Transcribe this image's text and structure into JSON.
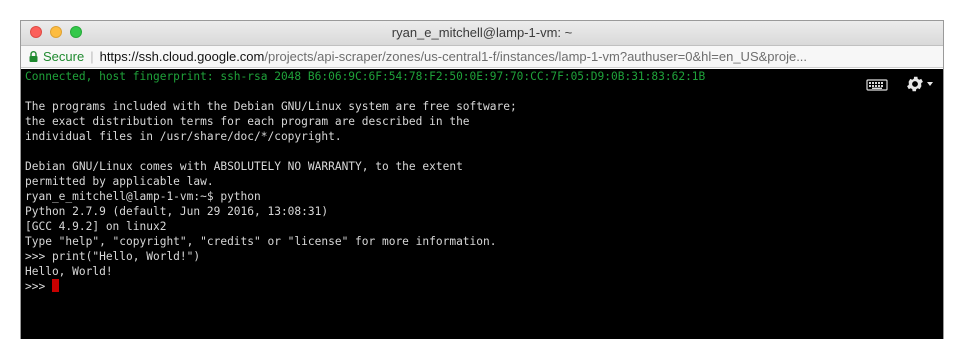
{
  "window": {
    "title": "ryan_e_mitchell@lamp-1-vm: ~"
  },
  "address_bar": {
    "secure_label": "Secure",
    "url_scheme": "https://",
    "url_host": "ssh.cloud.google.com",
    "url_path": "/projects/api-scraper/zones/us-central1-f/instances/lamp-1-vm?authuser=0&hl=en_US&proje..."
  },
  "terminal": {
    "connected": "Connected, host fingerprint: ssh-rsa 2048 B6:06:9C:6F:54:78:F2:50:0E:97:70:CC:7F:05:D9:0B:31:83:62:1B",
    "lines": [
      "The programs included with the Debian GNU/Linux system are free software;",
      "the exact distribution terms for each program are described in the",
      "individual files in /usr/share/doc/*/copyright.",
      "Debian GNU/Linux comes with ABSOLUTELY NO WARRANTY, to the extent",
      "permitted by applicable law.",
      "ryan_e_mitchell@lamp-1-vm:~$ python",
      "Python 2.7.9 (default, Jun 29 2016, 13:08:31)",
      "[GCC 4.9.2] on linux2",
      "Type \"help\", \"copyright\", \"credits\" or \"license\" for more information.",
      ">>> print(\"Hello, World!\")",
      "Hello, World!"
    ],
    "prompt": ">>> "
  },
  "colors": {
    "connected_text": "#1fa23a",
    "cursor": "#c80000",
    "secure": "#1f8a2f"
  },
  "icons": [
    "keyboard-icon",
    "gear-icon",
    "caret-down-icon",
    "lock-icon"
  ]
}
